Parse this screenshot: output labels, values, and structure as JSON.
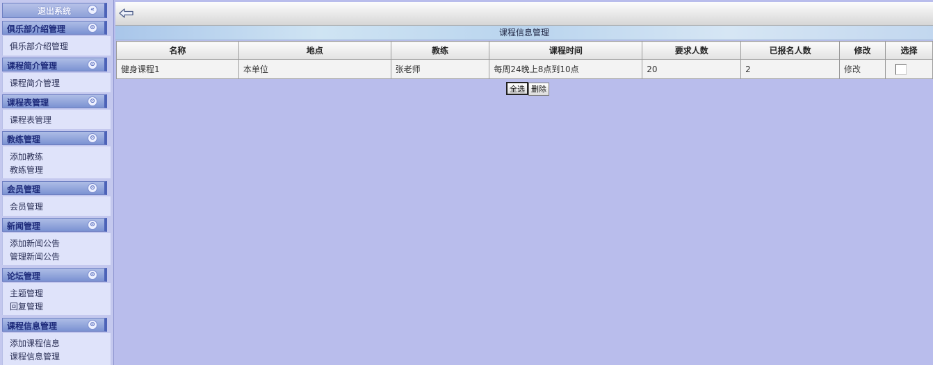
{
  "sidebar": {
    "logout_label": "退出系统",
    "sections": [
      {
        "title": "俱乐部介绍管理",
        "links": [
          "俱乐部介绍管理"
        ]
      },
      {
        "title": "课程简介管理",
        "links": [
          "课程简介管理"
        ]
      },
      {
        "title": "课程表管理",
        "links": [
          "课程表管理"
        ]
      },
      {
        "title": "教练管理",
        "links": [
          "添加教练",
          "教练管理"
        ]
      },
      {
        "title": "会员管理",
        "links": [
          "会员管理"
        ]
      },
      {
        "title": "新闻管理",
        "links": [
          "添加新闻公告",
          "管理新闻公告"
        ]
      },
      {
        "title": "论坛管理",
        "links": [
          "主题管理",
          "回复管理"
        ]
      },
      {
        "title": "课程信息管理",
        "links": [
          "添加课程信息",
          "课程信息管理"
        ]
      }
    ]
  },
  "panel": {
    "title": "课程信息管理"
  },
  "table": {
    "headers": [
      "名称",
      "地点",
      "教练",
      "课程时间",
      "要求人数",
      "已报名人数",
      "修改",
      "选择"
    ],
    "rows": [
      [
        "健身课程1",
        "本单位",
        "张老师",
        "每周24晚上8点到10点",
        "20",
        "2",
        "修改",
        ""
      ]
    ]
  },
  "buttons": {
    "select_all": "全选",
    "delete": "删除"
  },
  "icons": {
    "back": "arrow-left-icon",
    "collapse": "double-chevron-icon"
  }
}
